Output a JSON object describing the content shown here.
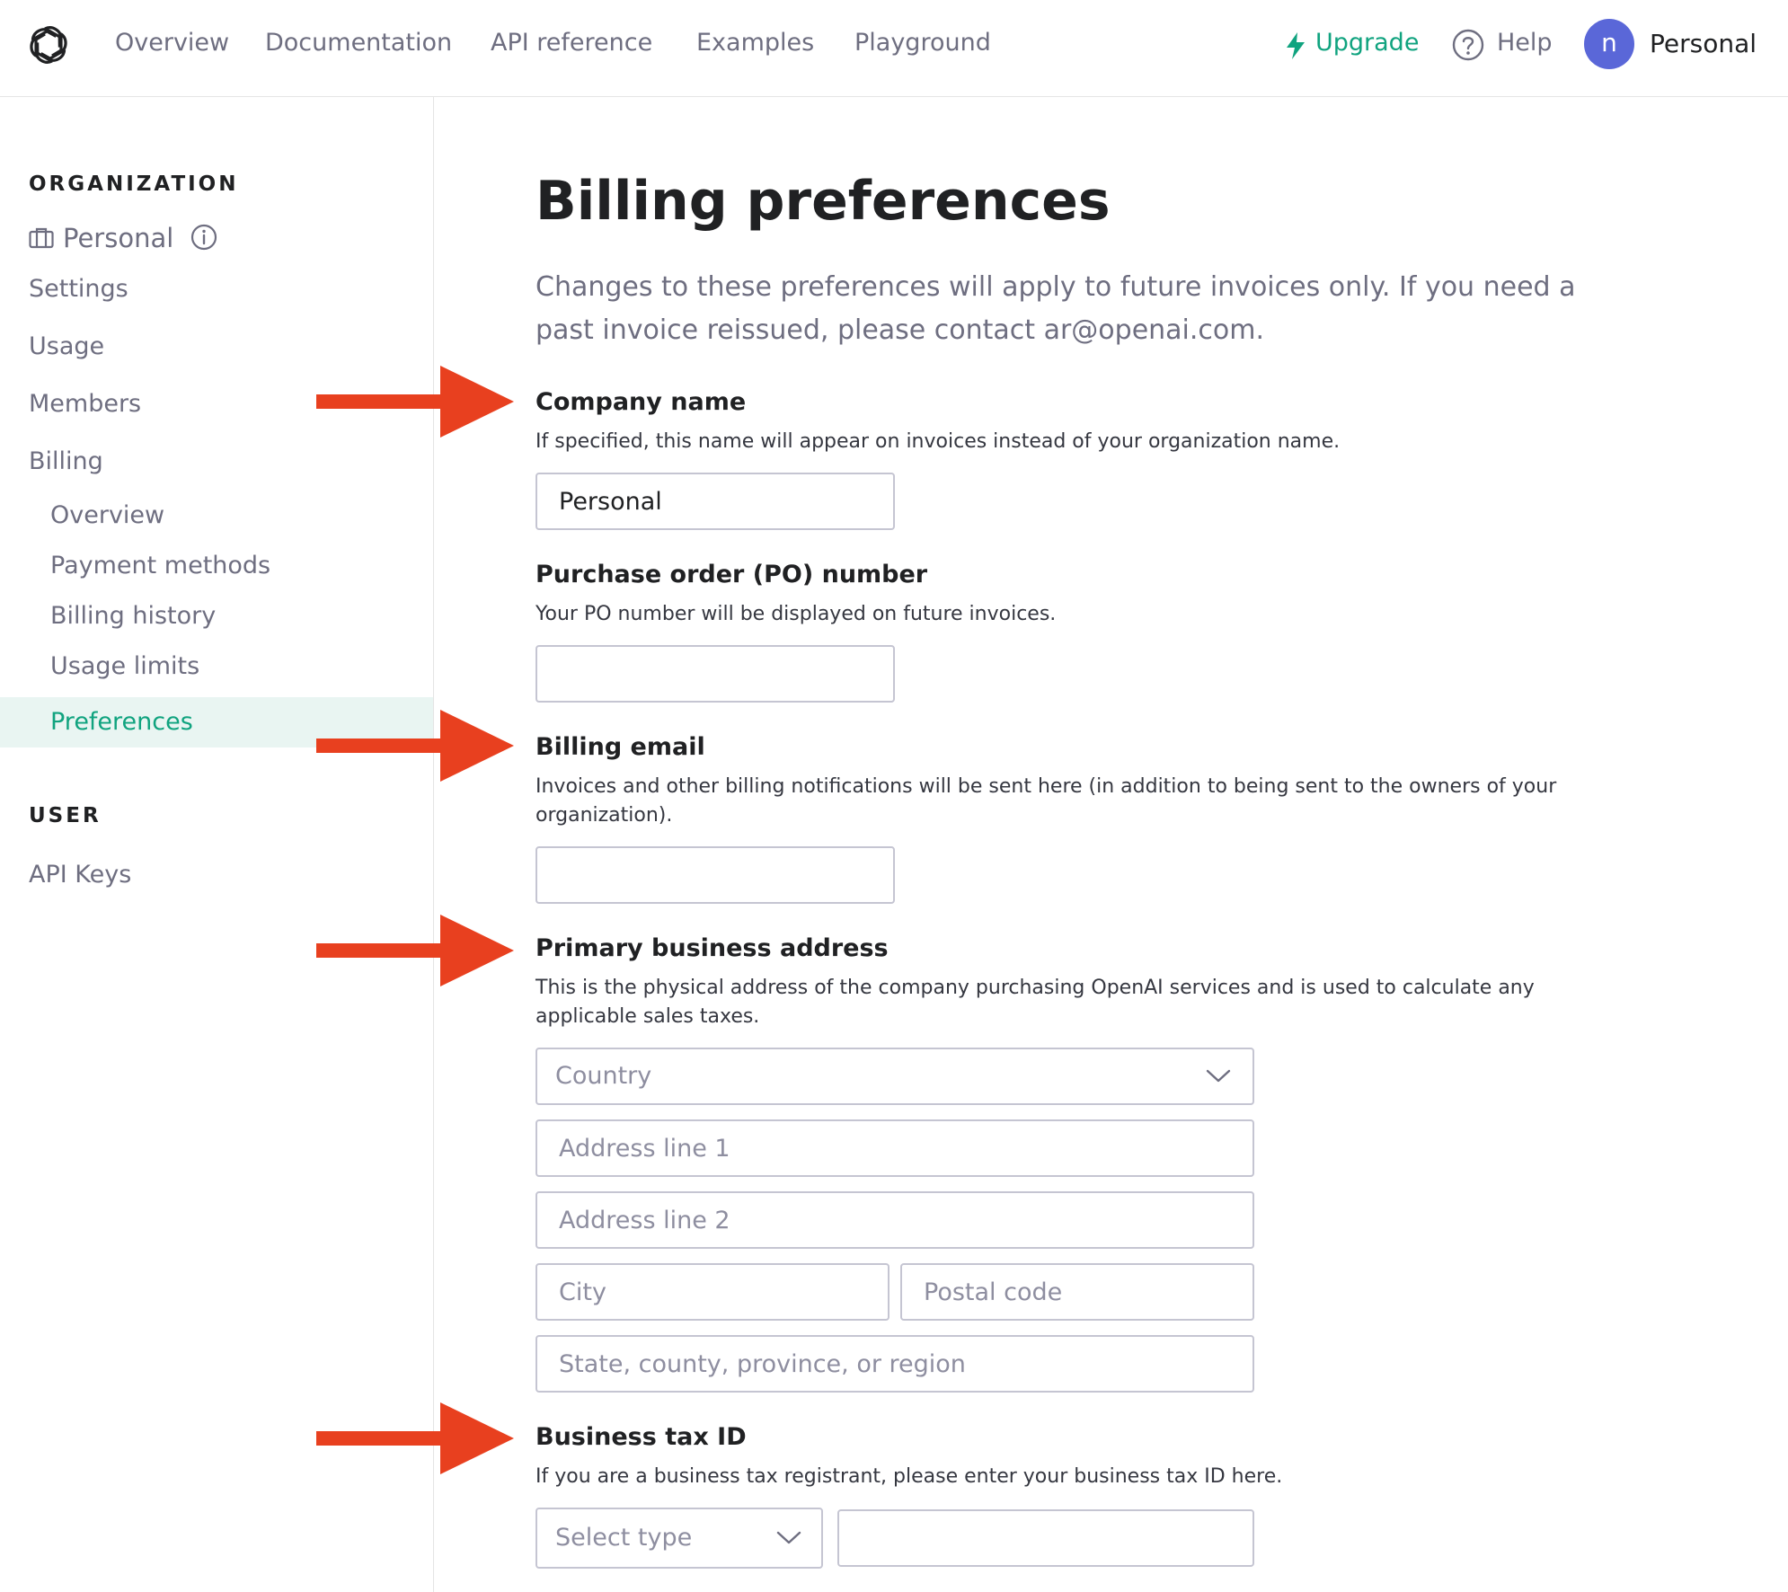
{
  "nav": {
    "links": [
      "Overview",
      "Documentation",
      "API reference",
      "Examples",
      "Playground"
    ],
    "upgrade": "Upgrade",
    "help": "Help",
    "avatar_initial": "n",
    "account": "Personal"
  },
  "sidebar": {
    "org_heading": "ORGANIZATION",
    "org_name": "Personal",
    "items": [
      "Settings",
      "Usage",
      "Members",
      "Billing"
    ],
    "billing_sub": [
      "Overview",
      "Payment methods",
      "Billing history",
      "Usage limits",
      "Preferences"
    ],
    "active_item": "Preferences",
    "user_heading": "USER",
    "user_items": [
      "API Keys"
    ]
  },
  "main": {
    "title": "Billing preferences",
    "intro": "Changes to these preferences will apply to future invoices only. If you need a past invoice reissued, please contact ar@openai.com.",
    "company": {
      "title": "Company name",
      "desc": "If specified, this name will appear on invoices instead of your organization name.",
      "value": "Personal"
    },
    "po": {
      "title": "Purchase order (PO) number",
      "desc": "Your PO number will be displayed on future invoices.",
      "value": ""
    },
    "email": {
      "title": "Billing email",
      "desc": "Invoices and other billing notifications will be sent here (in addition to being sent to the owners of your organization).",
      "value": ""
    },
    "address": {
      "title": "Primary business address",
      "desc": "This is the physical address of the company purchasing OpenAI services and is used to calculate any applicable sales taxes.",
      "country_placeholder": "Country",
      "line1_placeholder": "Address line 1",
      "line2_placeholder": "Address line 2",
      "city_placeholder": "City",
      "postal_placeholder": "Postal code",
      "state_placeholder": "State, county, province, or region"
    },
    "tax": {
      "title": "Business tax ID",
      "desc": "If you are a business tax registrant, please enter your business tax ID here.",
      "type_placeholder": "Select type",
      "value": ""
    }
  },
  "colors": {
    "accent": "#10a37f",
    "annotation_arrow": "#e8401f",
    "avatar": "#5a67d8",
    "active_bg": "#e9f5f2"
  },
  "icons": [
    "openai-logo-icon",
    "lightning-icon",
    "help-circle-icon",
    "briefcase-icon",
    "info-icon",
    "chevron-down-icon",
    "annotation-arrow-icon"
  ]
}
